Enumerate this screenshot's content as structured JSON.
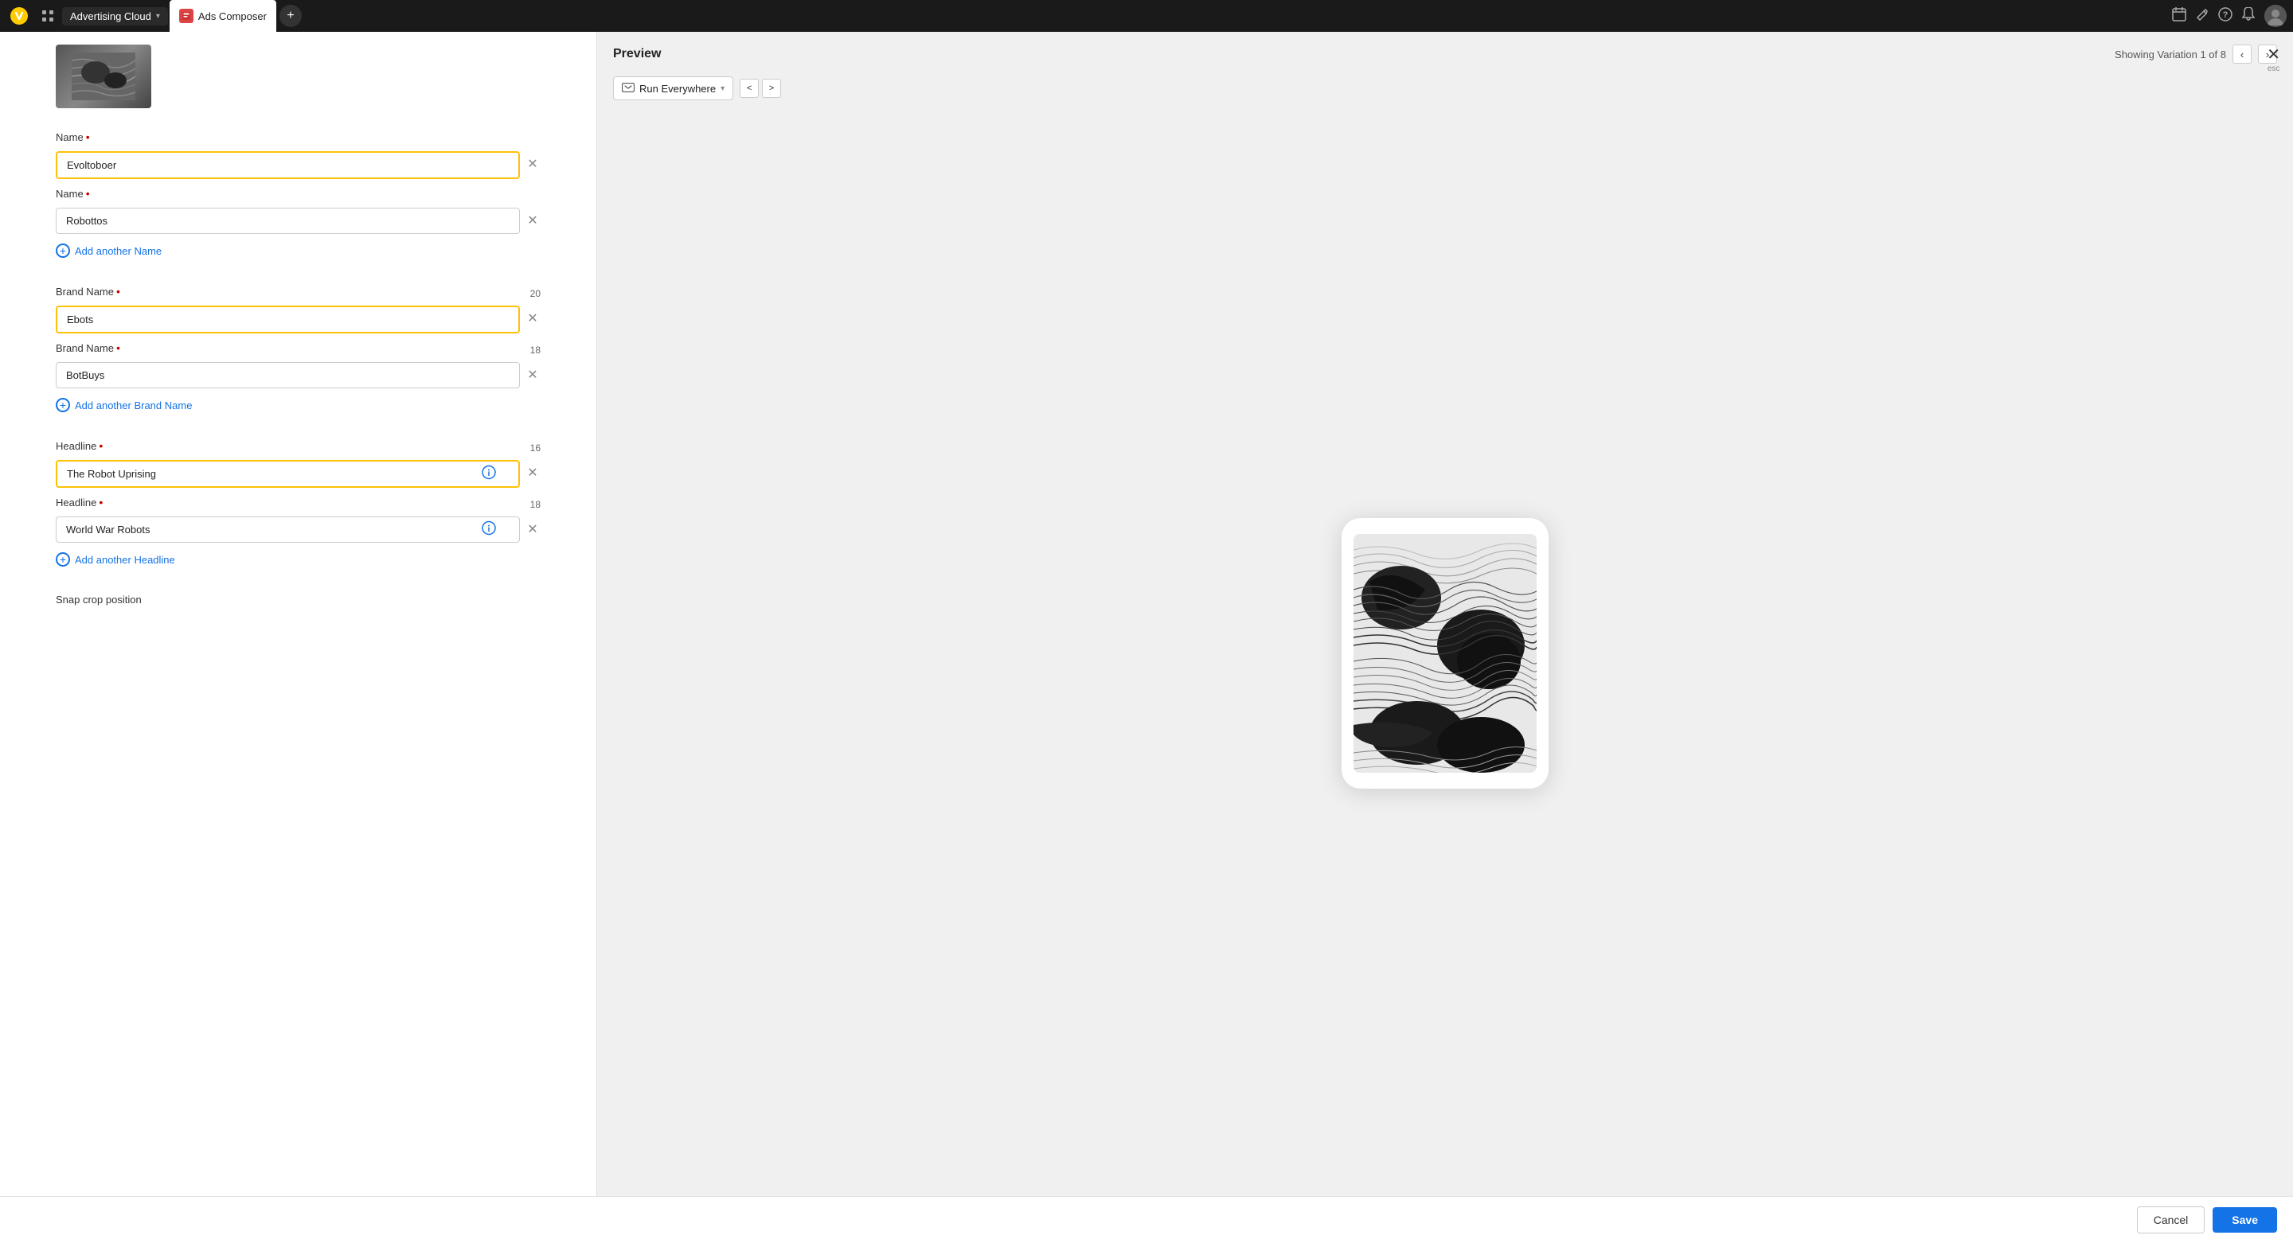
{
  "topnav": {
    "app_name": "Advertising Cloud",
    "app_chevron": "▾",
    "tab_label": "Ads Composer",
    "plus_label": "+"
  },
  "preview": {
    "title": "Preview",
    "variation_text": "Showing Variation 1 of 8",
    "channel": "Run Everywhere",
    "close_label": "✕",
    "esc_label": "esc"
  },
  "form": {
    "image_alt": "Ad image thumbnail",
    "fields": [
      {
        "section": "name",
        "entries": [
          {
            "label": "Name",
            "required": true,
            "value": "Evoltoboer",
            "highlighted": true,
            "char_count": null,
            "has_icon": false
          },
          {
            "label": "Name",
            "required": true,
            "value": "Robottos",
            "highlighted": false,
            "char_count": null,
            "has_icon": false
          }
        ],
        "add_label": "Add another Name"
      },
      {
        "section": "brand_name",
        "entries": [
          {
            "label": "Brand Name",
            "required": true,
            "value": "Ebots",
            "highlighted": true,
            "char_count": "20",
            "has_icon": false
          },
          {
            "label": "Brand Name",
            "required": true,
            "value": "BotBuys",
            "highlighted": false,
            "char_count": "18",
            "has_icon": false
          }
        ],
        "add_label": "Add another Brand Name"
      },
      {
        "section": "headline",
        "entries": [
          {
            "label": "Headline",
            "required": true,
            "value": "The Robot Uprising",
            "highlighted": true,
            "char_count": "16",
            "has_icon": true
          },
          {
            "label": "Headline",
            "required": true,
            "value": "World War Robots",
            "highlighted": false,
            "char_count": "18",
            "has_icon": true
          }
        ],
        "add_label": "Add another Headline"
      }
    ],
    "snap_crop_label": "Snap crop position"
  },
  "buttons": {
    "cancel": "Cancel",
    "save": "Save"
  }
}
